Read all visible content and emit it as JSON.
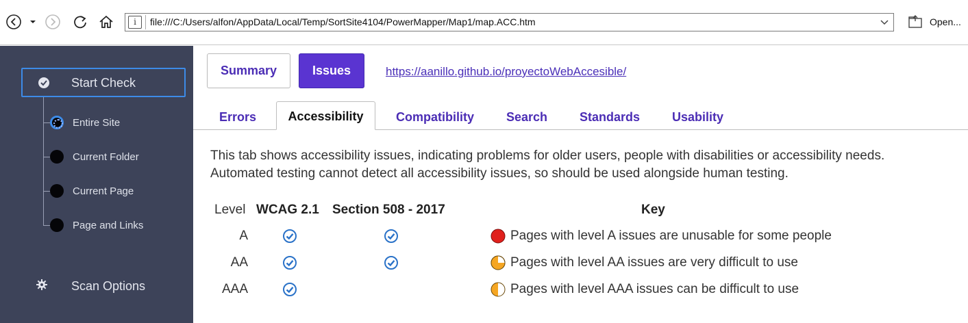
{
  "browser": {
    "address": "file:///C:/Users/alfon/AppData/Local/Temp/SortSite4104/PowerMapper/Map1/map.ACC.htm",
    "open_label": "Open...",
    "info_glyph": "i"
  },
  "sidebar": {
    "start_check": "Start Check",
    "items": [
      {
        "label": "Entire Site",
        "selected": true
      },
      {
        "label": "Current Folder",
        "selected": false
      },
      {
        "label": "Current Page",
        "selected": false
      },
      {
        "label": "Page and Links",
        "selected": false
      }
    ],
    "scan_options": "Scan Options"
  },
  "main": {
    "summary_label": "Summary",
    "issues_label": "Issues",
    "site_url": "https://aanillo.github.io/proyectoWebAccesible/",
    "tabs": [
      "Errors",
      "Accessibility",
      "Compatibility",
      "Search",
      "Standards",
      "Usability"
    ],
    "active_tab": "Accessibility",
    "description_line1": "This tab shows accessibility issues, indicating problems for older users, people with disabilities or accessibility needs.",
    "description_line2": "Automated testing cannot detect all accessibility issues, so should be used alongside human testing.",
    "table": {
      "headers": {
        "level": "Level",
        "wcag": "WCAG 2.1",
        "section508": "Section 508 - 2017",
        "key": "Key"
      },
      "rows": [
        {
          "level": "A",
          "wcag": true,
          "section508": true,
          "key": "Pages with level A issues are unusable for some people",
          "key_icon": "red-full-circle-icon"
        },
        {
          "level": "AA",
          "wcag": true,
          "section508": true,
          "key": "Pages with level AA issues are very difficult to use",
          "key_icon": "orange-three-quarter-circle-icon"
        },
        {
          "level": "AAA",
          "wcag": true,
          "section508": false,
          "key": "Pages with level AAA issues can be difficult to use",
          "key_icon": "orange-half-circle-icon"
        }
      ]
    }
  },
  "colors": {
    "sidebar_bg": "#3d4359",
    "accent_blue": "#3d8be8",
    "brand_purple": "#5a34d1",
    "link_purple": "#4a2fb8",
    "check_blue": "#2a72c8",
    "level_a_red": "#e0201c",
    "level_aa_orange": "#f5a623"
  }
}
